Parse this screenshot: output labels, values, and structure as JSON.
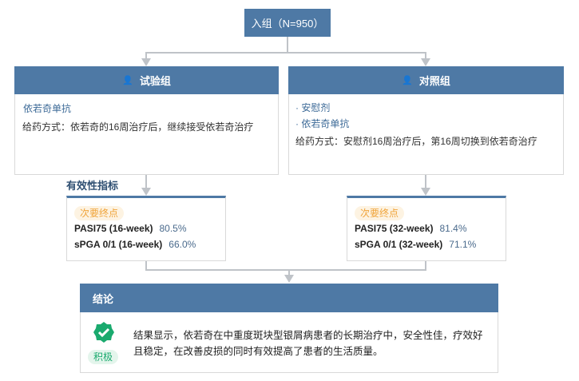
{
  "top": {
    "label": "入组（N=950）"
  },
  "trial": {
    "title": "试验组",
    "drug": "依若奇单抗",
    "dosing": "给药方式：依若奇的16周治疗后，继续接受依若奇治疗"
  },
  "control": {
    "title": "对照组",
    "items": [
      "安慰剂",
      "依若奇单抗"
    ],
    "dosing": "给药方式：安慰剂16周治疗后，第16周切换到依若奇治疗"
  },
  "efficacy_label": "有效性指标",
  "trial_metrics": {
    "tag": "次要终点",
    "rows": [
      {
        "name": "PASI75 (16-week)",
        "value": "80.5%"
      },
      {
        "name": "sPGA 0/1 (16-week)",
        "value": "66.0%"
      }
    ]
  },
  "control_metrics": {
    "tag": "次要终点",
    "rows": [
      {
        "name": "PASI75 (32-week)",
        "value": "81.4%"
      },
      {
        "name": "sPGA 0/1 (32-week)",
        "value": "71.1%"
      }
    ]
  },
  "conclusion": {
    "title": "结论",
    "badge": "积极",
    "text": "结果显示，依若奇在中重度斑块型银屑病患者的长期治疗中，安全性佳，疗效好且稳定，在改善皮损的同时有效提高了患者的生活质量。"
  },
  "colors": {
    "header": "#4e79a5",
    "positive": "#1aaa6e",
    "tag": "#f0a43a"
  }
}
